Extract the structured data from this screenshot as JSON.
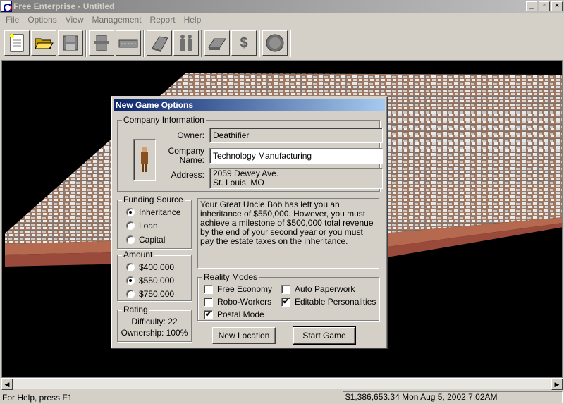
{
  "window": {
    "title": "Free Enterprise - Untitled",
    "buttons": [
      "_",
      "▫",
      "×"
    ]
  },
  "menu": [
    "File",
    "Options",
    "View",
    "Management",
    "Report",
    "Help"
  ],
  "toolbar": {
    "buttons": [
      "new-file",
      "open-folder",
      "save-disk",
      "building",
      "road",
      "book",
      "people",
      "box",
      "dollar",
      "globe"
    ],
    "dollar_glyph": "$"
  },
  "dialog": {
    "title": "New Game Options",
    "company": {
      "group_label": "Company Information",
      "owner_label": "Owner:",
      "owner_value": "Deathifier",
      "name_label_1": "Company",
      "name_label_2": "Name:",
      "name_value": "Technology Manufacturing",
      "address_label": "Address:",
      "address_line1": "2059 Dewey Ave.",
      "address_line2": "St. Louis, MO"
    },
    "funding": {
      "group_label": "Funding Source",
      "options": [
        "Inheritance",
        "Loan",
        "Capital"
      ],
      "selected": "Inheritance"
    },
    "amount": {
      "group_label": "Amount",
      "options": [
        "$400,000",
        "$550,000",
        "$750,000"
      ],
      "selected": "$550,000"
    },
    "rating": {
      "group_label": "Rating",
      "difficulty": "Difficulty: 22",
      "ownership": "Ownership: 100%"
    },
    "description": "Your Great Uncle Bob has left you an inheritance of $550,000.  However, you must achieve a milestone of $500,000 total revenue by the end of your second year or you must pay the estate taxes on the inheritance.",
    "reality": {
      "group_label": "Reality Modes",
      "free_economy": "Free Economy",
      "robo_workers": "Robo-Workers",
      "postal_mode": "Postal Mode",
      "auto_paperwork": "Auto Paperwork",
      "editable_personalities": "Editable Personalities"
    },
    "buttons": {
      "new_location": "New Location",
      "start_game": "Start Game"
    }
  },
  "status": {
    "help": "For Help, press F1",
    "info": "$1,386,653.34  Mon Aug 5, 2002  7:02AM"
  },
  "colors": {
    "title_active": "#0a246a",
    "face": "#d4d0c8",
    "viewport": "#000000",
    "terrain": "#b07850"
  }
}
